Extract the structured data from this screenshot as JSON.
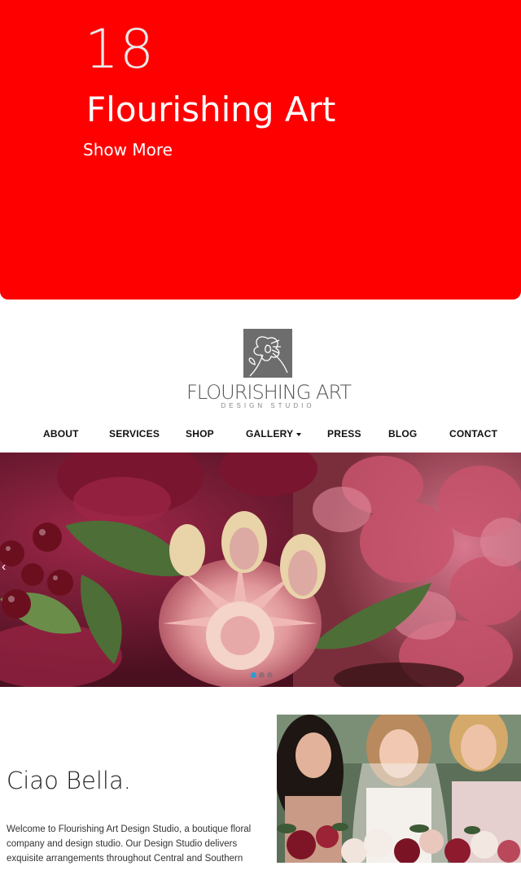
{
  "promo": {
    "number": "18",
    "title": "Flourishing Art",
    "link_label": "Show More",
    "background": "#ff0000"
  },
  "logo": {
    "name": "FLOURISHING ART",
    "subtitle": "DESIGN STUDIO",
    "icon": "flower-logo-icon"
  },
  "nav": {
    "items": [
      {
        "label": "ABOUT"
      },
      {
        "label": "SERVICES"
      },
      {
        "label": "SHOP"
      },
      {
        "label": "GALLERY",
        "dropdown": true
      },
      {
        "label": "PRESS"
      },
      {
        "label": "BLOG"
      },
      {
        "label": "CONTACT"
      }
    ]
  },
  "hero": {
    "slide_count": 3,
    "active_slide": 1,
    "icon_prev": "chevron-left-icon"
  },
  "about": {
    "heading": "Ciao Bella.",
    "intro": "Welcome to Flourishing Art Design Studio, a boutique floral company and design studio. Our Design Studio delivers exquisite arrangements throughout Central and Southern"
  },
  "colors": {
    "accent": "#2a9fd6",
    "nav_text": "#111111"
  }
}
